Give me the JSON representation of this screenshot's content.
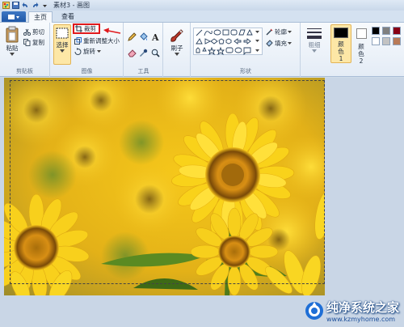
{
  "window": {
    "title": "素材3 - 画图"
  },
  "tabs": [
    {
      "label": "主页"
    },
    {
      "label": "查看"
    }
  ],
  "clipboard": {
    "paste_label": "粘贴",
    "cut_label": "剪切",
    "copy_label": "复制",
    "group_label": "剪贴板"
  },
  "image": {
    "select_label": "选择",
    "crop_label": "裁剪",
    "resize_label": "重新调整大小",
    "rotate_label": "旋转",
    "group_label": "图像"
  },
  "tools": {
    "group_label": "工具"
  },
  "brushes": {
    "label": "刷子"
  },
  "shapes": {
    "outline_label": "轮廓",
    "fill_label": "填充",
    "group_label": "形状"
  },
  "size": {
    "label": "粗细"
  },
  "colors": {
    "color1_label": "颜色 1",
    "color2_label": "颜色 2",
    "color1": "#000000",
    "color2": "#ffffff",
    "palette": [
      "#000000",
      "#7f7f7f",
      "#880015",
      "#ffffff",
      "#c3c3c3",
      "#b97a57"
    ]
  },
  "watermark": {
    "title": "纯净系统之家",
    "url": "www.kzmyhome.com"
  }
}
